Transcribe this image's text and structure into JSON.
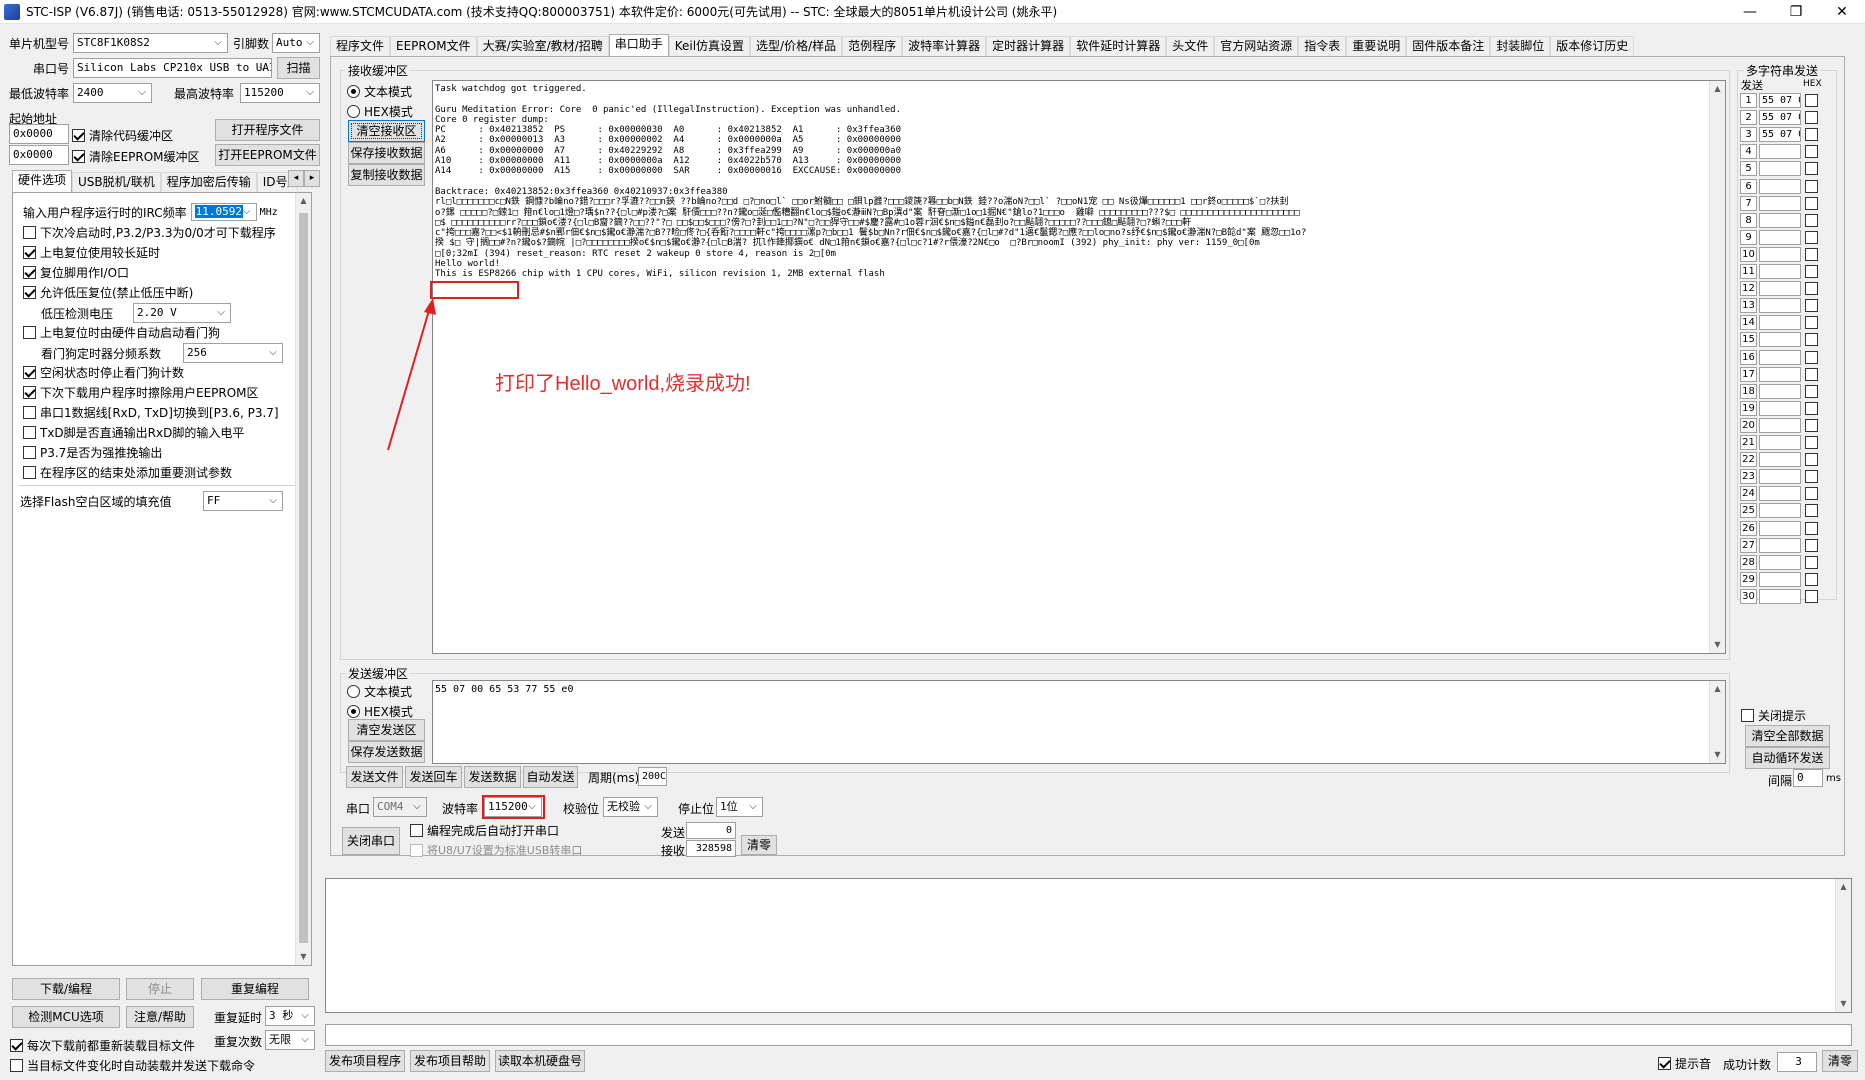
{
  "window": {
    "title": "STC-ISP (V6.87J) (销售电话: 0513-55012928) 官网:www.STCMCUDATA.com (技术支持QQ:800003751) 本软件定价: 6000元(可先试用) -- STC: 全球最大的8051单片机设计公司 (姚永平)",
    "min": "—",
    "max": "❐",
    "close": "✕"
  },
  "left": {
    "mcu_label": "单片机型号",
    "mcu_value": "STC8F1K08S2",
    "pin_label": "引脚数",
    "pin_value": "Auto",
    "port_label": "串口号",
    "port_value": "Silicon Labs CP210x USB to UAI",
    "scan_btn": "扫描",
    "min_baud_label": "最低波特率",
    "min_baud_value": "2400",
    "max_baud_label": "最高波特率",
    "max_baud_value": "115200",
    "start_addr_label": "起始地址",
    "addr1": "0x0000",
    "clear_code_label": "清除代码缓冲区",
    "open_prog_btn": "打开程序文件",
    "addr2": "0x0000",
    "clear_eeprom_label": "清除EEPROM缓冲区",
    "open_eeprom_btn": "打开EEPROM文件",
    "tabs": [
      "硬件选项",
      "USB脱机/联机",
      "程序加密后传输",
      "ID号/"
    ],
    "hw": {
      "irc_label": "输入用户程序运行时的IRC频率",
      "irc_value": "11.0592",
      "irc_unit": "MHz",
      "opt1": "下次冷启动时,P3.2/P3.3为0/0才可下载程序",
      "opt2": "上电复位使用较长延时",
      "opt3": "复位脚用作I/O口",
      "opt4": "允许低压复位(禁止低压中断)",
      "lvd_label": "低压检测电压",
      "lvd_value": "2.20 V",
      "opt5": "上电复位时由硬件自动启动看门狗",
      "wdt_label": "看门狗定时器分频系数",
      "wdt_value": "256",
      "opt6": "空闲状态时停止看门狗计数",
      "opt7": "下次下载用户程序时擦除用户EEPROM区",
      "opt8": "串口1数据线[RxD, TxD]切换到[P3.6, P3.7]",
      "opt9": "TxD脚是否直通输出RxD脚的输入电平",
      "opt10": "P3.7是否为强推挽输出",
      "opt11": "在程序区的结束处添加重要测试参数",
      "fill_label": "选择Flash空白区域的填充值",
      "fill_value": "FF"
    },
    "download_btn": "下载/编程",
    "stop_btn": "停止",
    "reprogram_btn": "重复编程",
    "detect_btn": "检测MCU选项",
    "help_btn": "注意/帮助",
    "repeat_delay_label": "重复延时",
    "repeat_delay_value": "3 秒",
    "repeat_count_label": "重复次数",
    "repeat_count_value": "无限",
    "reload_label": "每次下载前都重新装载目标文件",
    "auto_label": "当目标文件变化时自动装载并发送下载命令"
  },
  "top_tabs": [
    "程序文件",
    "EEPROM文件",
    "大赛/实验室/教材/招聘",
    "串口助手",
    "Keil仿真设置",
    "选型/价格/样品",
    "范例程序",
    "波特率计算器",
    "定时器计算器",
    "软件延时计算器",
    "头文件",
    "官方网站资源",
    "指令表",
    "重要说明",
    "固件版本备注",
    "封装脚位",
    "版本修订历史"
  ],
  "rx": {
    "group_title": "接收缓冲区",
    "text_mode": "文本模式",
    "hex_mode": "HEX模式",
    "clear_btn": "清空接收区",
    "save_btn": "保存接收数据",
    "copy_btn": "复制接收数据",
    "lines": [
      "Task watchdog got triggered.",
      "",
      "Guru Meditation Error: Core  0 panic'ed (IllegalInstruction). Exception was unhandled.",
      "Core 0 register dump:",
      "PC      : 0x40213852  PS      : 0x00000030  A0      : 0x40213852  A1      : 0x3ffea360",
      "A2      : 0x00000013  A3      : 0x00000002  A4      : 0x0000000a  A5      : 0x00000000",
      "A6      : 0x00000000  A7      : 0x40229292  A8      : 0x3ffea299  A9      : 0x000000a0",
      "A10     : 0x00000000  A11     : 0x0000000a  A12     : 0x4022b570  A13     : 0x00000000",
      "A14     : 0x00000000  A15     : 0x00000000  SAR     : 0x00000016  EXCCAUSE: 0x00000000",
      "",
      "Backtrace: 0x40213852:0x3ffea360 0x40210937:0x3ffea380",
      "rl□l□□□□□□□c□N鉄 鋼慷?b崘no?錯?□□□r?孚漉??□□n鋏 ??b崘no?□□d □?□no□l` □□or鮒髓□□ □鋇lp鼝?□□□鑁篪?篹□□b□N鉄 錴??o湍oN?□□l` ?□□oN1宠 □□ Ns彶爗□□□□□□1 □□r鉖o□□□□□$`□?扶刲",
      "o?鏍 □□□□□?□鎍1□ 箝n€lo□1燈□?瑀$n??{□l□#p溇?□案 馯儥□□□??n?鑨o□涎□儖糟翻n€lo□$鎰o€瀞ⅲN?□Bp潩d\"案 馯眘□澵□1o□1掘N€\"鎗lo?1□□□o  雞噼 □□□□□□□□□???$□ □□□□□□□□□□□□□□□□□□□□□□",
      "□$ □□□□□□□□□□rr?□□□鎖o€溇?{□l□B齏?鏑??□□??\"?□ □□$□□$□□□?傍?□?刲□□1□□?N\"□?□□猂守□□#$鏖?露#□1o蓉r洄€$n□$鎰n€磊刲o?□□颭翿?□□□□□??□□□鎴□颭翿?□?蝌?□□□軒",
      "c\"挎□□□嘉?□□<$1輈刪忌#$n鄲r佃€$n□$鑨o€瀞湍?□B??睑□佟?□{呑餰?□□□□軒c\"挎□□□□漯p?□b□□1 鬢$b□Nn?r佃€$n□$鑨o€嘉?{□l□#?d\"1邁€鬣鍶?□應?□□lo□no?s纾€$n□$鑨o€瀞湍N?□B旕d\"案 颼忽□□1o?",
      "揆 $□ 守|搁□□#?n?鑨o$?鏑帵 |□?□□□□□□□□揆o€$n□$鑨o€瀞?{□l□B湍? 扤l作鏲揶鐉o€ dN□1箝n€鎖o€嘉?{□l□c?1#?r偎濠?2N€□o  □?Br□noomI (392) phy_init: phy ver: 1159_0□[0m",
      "□[0;32mI (394) reset_reason: RTC reset 2 wakeup 0 store 4, reason is 2□[0m",
      "Hello world!",
      "This is ESP8266 chip with 1 CPU cores, WiFi, silicon revision 1, 2MB external flash"
    ]
  },
  "annotation": {
    "text": "打印了Hello_world,烧录成功!"
  },
  "multi": {
    "title": "多字符串发送",
    "col_send": "发送",
    "col_hex": "HEX",
    "rows": [
      {
        "n": "1",
        "v": "55 07 0"
      },
      {
        "n": "2",
        "v": "55 07 0"
      },
      {
        "n": "3",
        "v": "55 07 0"
      },
      {
        "n": "4",
        "v": ""
      },
      {
        "n": "5",
        "v": ""
      },
      {
        "n": "6",
        "v": ""
      },
      {
        "n": "7",
        "v": ""
      },
      {
        "n": "8",
        "v": ""
      },
      {
        "n": "9",
        "v": ""
      },
      {
        "n": "10",
        "v": ""
      },
      {
        "n": "11",
        "v": ""
      },
      {
        "n": "12",
        "v": ""
      },
      {
        "n": "13",
        "v": ""
      },
      {
        "n": "14",
        "v": ""
      },
      {
        "n": "15",
        "v": ""
      },
      {
        "n": "16",
        "v": ""
      },
      {
        "n": "17",
        "v": ""
      },
      {
        "n": "18",
        "v": ""
      },
      {
        "n": "19",
        "v": ""
      },
      {
        "n": "20",
        "v": ""
      },
      {
        "n": "21",
        "v": ""
      },
      {
        "n": "22",
        "v": ""
      },
      {
        "n": "23",
        "v": ""
      },
      {
        "n": "24",
        "v": ""
      },
      {
        "n": "25",
        "v": ""
      },
      {
        "n": "26",
        "v": ""
      },
      {
        "n": "27",
        "v": ""
      },
      {
        "n": "28",
        "v": ""
      },
      {
        "n": "29",
        "v": ""
      },
      {
        "n": "30",
        "v": ""
      }
    ],
    "close_tip": "关闭提示",
    "clear_all_btn": "清空全部数据",
    "auto_loop_btn": "自动循环发送",
    "interval_label": "间隔",
    "interval_value": "0",
    "interval_unit": "ms"
  },
  "tx": {
    "group_title": "发送缓冲区",
    "text_mode": "文本模式",
    "hex_mode": "HEX模式",
    "clear_btn": "清空发送区",
    "save_btn": "保存发送数据",
    "content": "55 07 00 65 53 77 55 e0",
    "send_file_btn": "发送文件",
    "send_cr_btn": "发送回车",
    "send_data_btn": "发送数据",
    "auto_send_btn": "自动发送",
    "period_label": "周期(ms)",
    "period_value": "200C"
  },
  "serial": {
    "port_label": "串口",
    "port_value": "COM4",
    "baud_label": "波特率",
    "baud_value": "115200",
    "parity_label": "校验位",
    "parity_value": "无校验",
    "stop_label": "停止位",
    "stop_value": "1位",
    "close_btn": "关闭串口",
    "auto_open_label": "编程完成后自动打开串口",
    "usb_label": "将U8/U7设置为标准USB转串口",
    "sent_label": "发送",
    "sent_value": "0",
    "recv_label": "接收",
    "recv_value": "328598",
    "clear_btn": "清零"
  },
  "bottom": {
    "publish_btn": "发布项目程序",
    "publish_help_btn": "发布项目帮助",
    "read_disk_btn": "读取本机硬盘号",
    "sound_label": "提示音",
    "success_label": "成功计数",
    "success_value": "3",
    "clear_btn": "清零"
  }
}
